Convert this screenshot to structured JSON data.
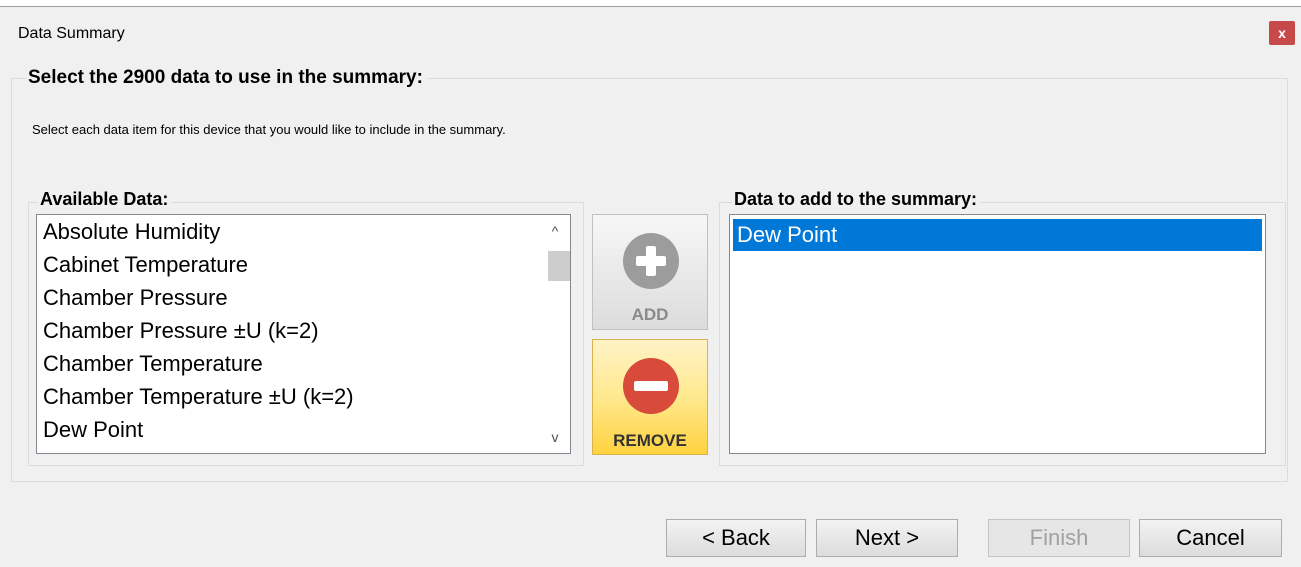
{
  "window": {
    "title": "Data Summary",
    "close_label": "x"
  },
  "main_group": {
    "title": "Select the 2900 data to use in the summary:",
    "instruction": "Select each data item for this device that you would like to include in the summary."
  },
  "available": {
    "title": "Available Data:",
    "items": [
      "Absolute Humidity",
      "Cabinet Temperature",
      "Chamber Pressure",
      "Chamber Pressure ±U (k=2)",
      "Chamber Temperature",
      "Chamber Temperature ±U (k=2)",
      "Dew Point"
    ],
    "scroll_up_glyph": "^",
    "scroll_down_glyph": "v"
  },
  "actions": {
    "add_label": "ADD",
    "remove_label": "REMOVE"
  },
  "selected": {
    "title": "Data to add to the summary:",
    "items": [
      "Dew Point"
    ],
    "selected_color": "#0078d7"
  },
  "wizard": {
    "back_label": "< Back",
    "next_label": "Next >",
    "finish_label": "Finish",
    "cancel_label": "Cancel",
    "finish_disabled": true
  }
}
